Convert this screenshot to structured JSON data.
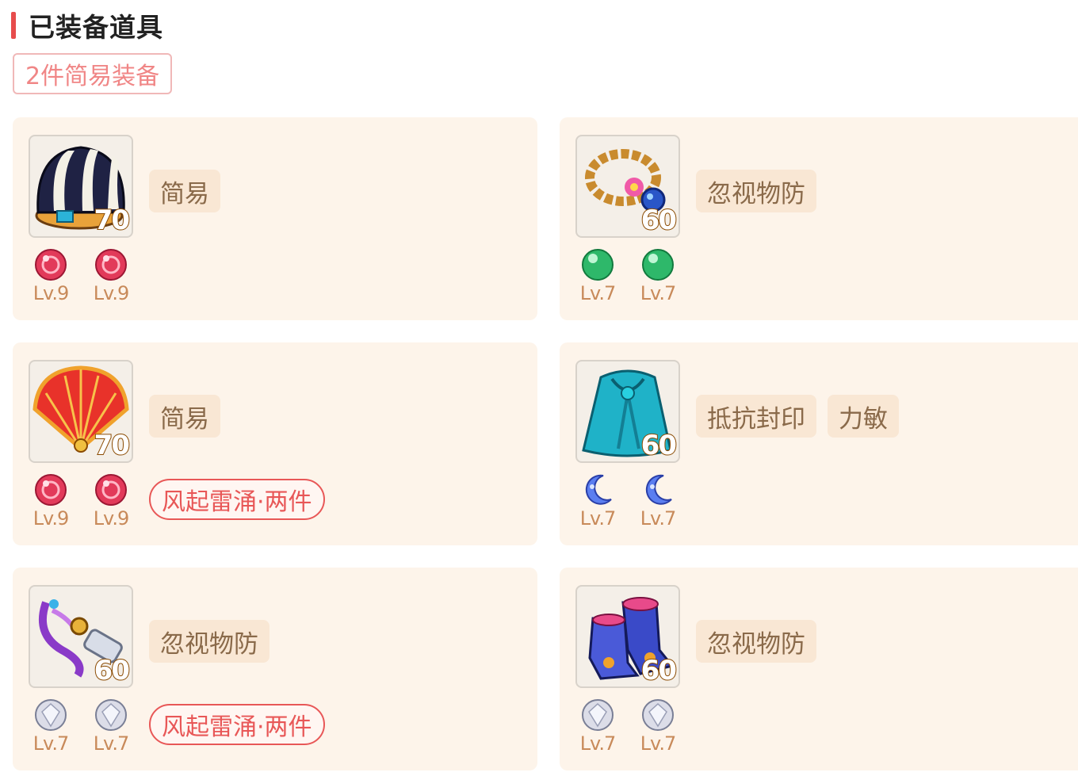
{
  "header": {
    "title": "已装备道具"
  },
  "set_badge": "2件简易装备",
  "items": [
    {
      "icon": "hat-icon",
      "level": "70",
      "tags": [
        "简易"
      ],
      "gems": [
        {
          "type": "red-gem",
          "lv": "Lv.9"
        },
        {
          "type": "red-gem",
          "lv": "Lv.9"
        }
      ],
      "set": ""
    },
    {
      "icon": "necklace-icon",
      "level": "60",
      "tags": [
        "忽视物防"
      ],
      "gems": [
        {
          "type": "green-gem",
          "lv": "Lv.7"
        },
        {
          "type": "green-gem",
          "lv": "Lv.7"
        }
      ],
      "set": ""
    },
    {
      "icon": "fan-weapon-icon",
      "level": "70",
      "tags": [
        "简易"
      ],
      "gems": [
        {
          "type": "red-gem",
          "lv": "Lv.9"
        },
        {
          "type": "red-gem",
          "lv": "Lv.9"
        }
      ],
      "set": "风起雷涌·两件"
    },
    {
      "icon": "robe-armor-icon",
      "level": "60",
      "tags": [
        "抵抗封印",
        "力敏"
      ],
      "gems": [
        {
          "type": "moon-gem",
          "lv": "Lv.7"
        },
        {
          "type": "moon-gem",
          "lv": "Lv.7"
        }
      ],
      "set": ""
    },
    {
      "icon": "belt-icon",
      "level": "60",
      "tags": [
        "忽视物防"
      ],
      "gems": [
        {
          "type": "white-gem",
          "lv": "Lv.7"
        },
        {
          "type": "white-gem",
          "lv": "Lv.7"
        }
      ],
      "set": "风起雷涌·两件"
    },
    {
      "icon": "boots-icon",
      "level": "60",
      "tags": [
        "忽视物防"
      ],
      "gems": [
        {
          "type": "white-gem",
          "lv": "Lv.7"
        },
        {
          "type": "white-gem",
          "lv": "Lv.7"
        }
      ],
      "set": ""
    }
  ],
  "colors": {
    "accent": "#e74c4c",
    "card_bg": "#fdf4ea",
    "tag_bg": "#f9e7d4",
    "set_border": "#e85757"
  }
}
